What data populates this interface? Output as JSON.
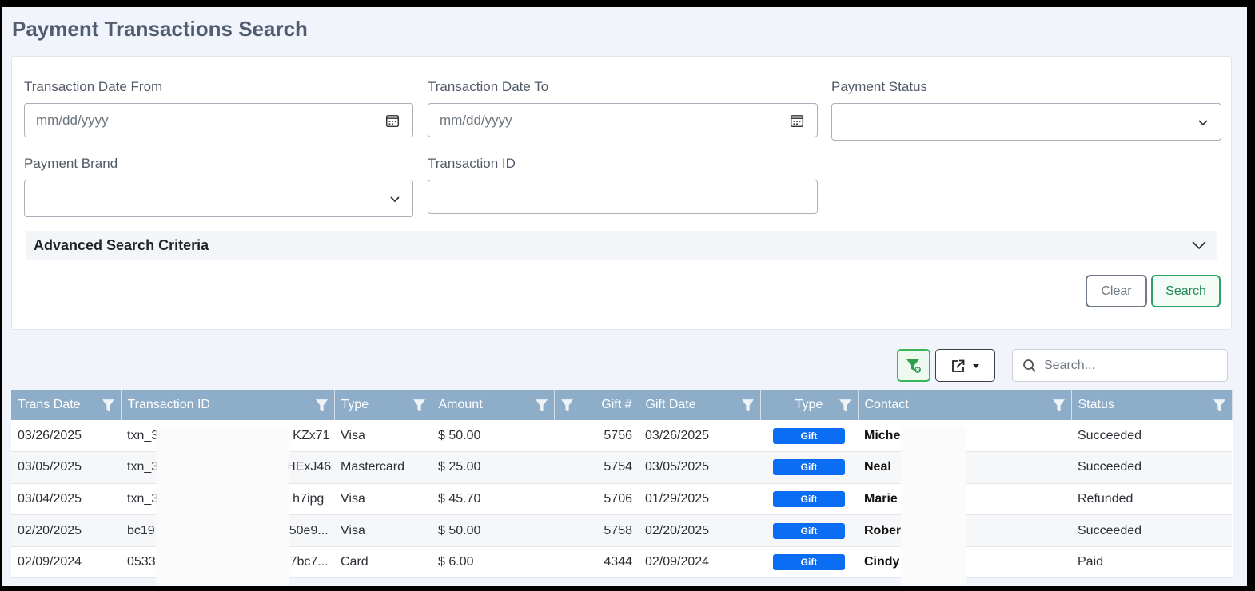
{
  "page": {
    "title": "Payment Transactions Search"
  },
  "form": {
    "date_from": {
      "label": "Transaction Date From",
      "placeholder": "mm/dd/yyyy"
    },
    "date_to": {
      "label": "Transaction Date To",
      "placeholder": "mm/dd/yyyy"
    },
    "payment_status": {
      "label": "Payment Status",
      "value": ""
    },
    "payment_brand": {
      "label": "Payment Brand",
      "value": ""
    },
    "transaction_id": {
      "label": "Transaction ID",
      "value": ""
    },
    "advanced_label": "Advanced Search Criteria",
    "clear_label": "Clear",
    "search_label": "Search"
  },
  "toolbar": {
    "search_placeholder": "Search...",
    "filter_icon": "filter-clear-icon",
    "export_icon": "export-icon"
  },
  "colors": {
    "header_bg": "#8eadc9",
    "badge_bg": "#0b6cf4",
    "search_green": "#2ea166"
  },
  "table": {
    "columns": [
      "Trans Date",
      "Transaction ID",
      "Type",
      "Amount",
      "Gift #",
      "Gift Date",
      "Type",
      "Contact",
      "Status"
    ],
    "rows": [
      {
        "trans_date": "03/26/2025",
        "txn_prefix": "txn_3",
        "txn_suffix": "KZx71",
        "type": "Visa",
        "amount": "$ 50.00",
        "gift_no": "5756",
        "gift_date": "03/26/2025",
        "gift_type": "Gift",
        "contact": "Miche",
        "status": "Succeeded"
      },
      {
        "trans_date": "03/05/2025",
        "txn_prefix": "txn_3",
        "txn_suffix": "HExJ46",
        "type": "Mastercard",
        "amount": "$ 25.00",
        "gift_no": "5754",
        "gift_date": "03/05/2025",
        "gift_type": "Gift",
        "contact": "Neal",
        "status": "Succeeded"
      },
      {
        "trans_date": "03/04/2025",
        "txn_prefix": "txn_3",
        "txn_suffix": "h7ipg",
        "type": "Visa",
        "amount": "$ 45.70",
        "gift_no": "5706",
        "gift_date": "01/29/2025",
        "gift_type": "Gift",
        "contact": "Marie",
        "status": "Refunded"
      },
      {
        "trans_date": "02/20/2025",
        "txn_prefix": "bc19",
        "txn_suffix": "50e9...",
        "type": "Visa",
        "amount": "$ 50.00",
        "gift_no": "5758",
        "gift_date": "02/20/2025",
        "gift_type": "Gift",
        "contact": "Rober",
        "status": "Succeeded"
      },
      {
        "trans_date": "02/09/2024",
        "txn_prefix": "0533",
        "txn_suffix": "7bc7...",
        "type": "Card",
        "amount": "$ 6.00",
        "gift_no": "4344",
        "gift_date": "02/09/2024",
        "gift_type": "Gift",
        "contact": "Cindy",
        "status": "Paid"
      }
    ]
  }
}
